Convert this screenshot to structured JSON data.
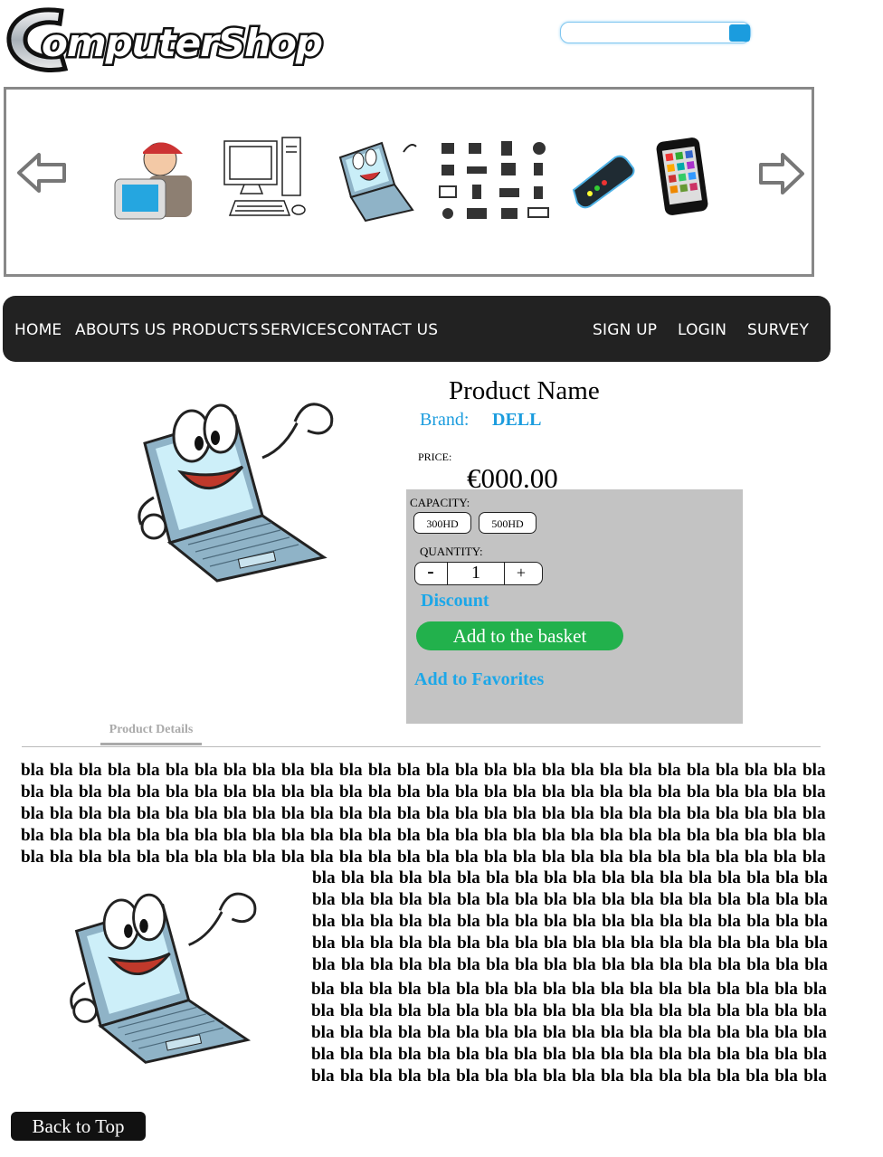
{
  "header": {
    "logo_text": "ComputerShop",
    "search": {
      "value": "",
      "placeholder": ""
    }
  },
  "carousel": {
    "prev_icon": "arrow-left-icon",
    "next_icon": "arrow-right-icon",
    "thumbnails": [
      "technician-icon",
      "desktop-pc-icon",
      "laptop-mascot-icon",
      "hardware-icons-grid",
      "smartphone-icon",
      "tablet-icon"
    ]
  },
  "nav": {
    "left": [
      "HOME",
      "ABOUTS US",
      "PRODUCTS",
      "SERVICES",
      "CONTACT US"
    ],
    "right": [
      "SIGN UP",
      "LOGIN",
      "SURVEY"
    ]
  },
  "product": {
    "name": "Product Name",
    "brand_label": "Brand:",
    "brand_value": "DELL",
    "price_label": "PRICE:",
    "price_value": "€000.00",
    "capacity_label": "CAPACITY:",
    "capacity_options": [
      "300HD",
      "500HD"
    ],
    "quantity_label": "QUANTITY:",
    "quantity_minus": "-",
    "quantity_value": "1",
    "quantity_plus": "+",
    "discount_label": "Discount",
    "add_to_basket": "Add to the basket",
    "add_to_favorites": "Add to Favorites"
  },
  "details": {
    "tab_label": "Product Details",
    "filler_word": "bla"
  },
  "footer": {
    "back_to_top": "Back to Top"
  },
  "colors": {
    "accent": "#1b9cde",
    "nav_bg": "#222222",
    "basket_green": "#22b14c",
    "options_bg": "#c3c3c3"
  }
}
